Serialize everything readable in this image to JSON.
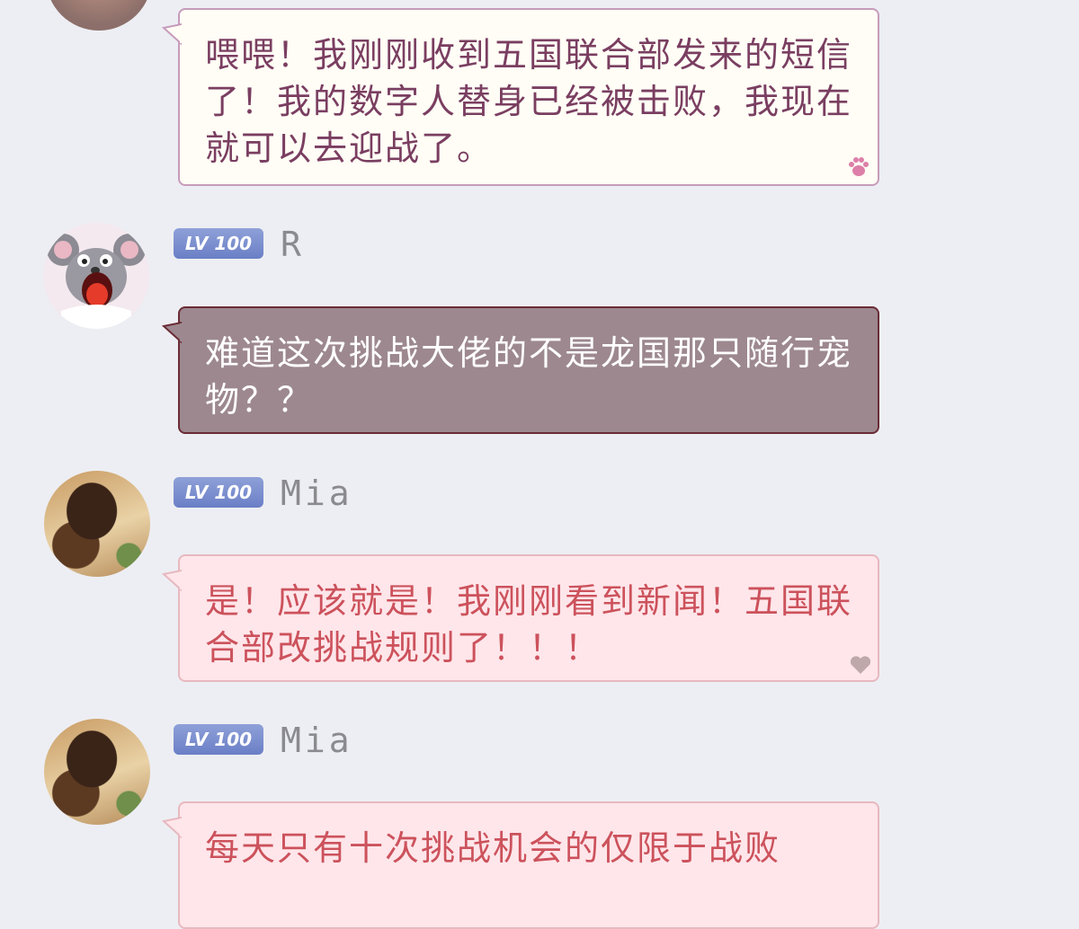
{
  "messages": [
    {
      "text": "喂喂！我刚刚收到五国联合部发来的短信了！我的数字人替身已经被击败，我现在就可以去迎战了。"
    },
    {
      "level": "LV 100",
      "username": "R",
      "text": "难道这次挑战大佬的不是龙国那只随行宠物？？"
    },
    {
      "level": "LV 100",
      "username": "Mia",
      "text": "是！应该就是！我刚刚看到新闻！五国联合部改挑战规则了！！！"
    },
    {
      "level": "LV 100",
      "username": "Mia",
      "text": "每天只有十次挑战机会的仅限于战败"
    }
  ],
  "colors": {
    "background": "#edeef3",
    "bubble_cream": "#fffdf5",
    "bubble_dark": "#9d8890",
    "bubble_pink": "#ffe6ea",
    "level_badge": "#7d90d0"
  },
  "icons": [
    "paw-icon",
    "heart-icon"
  ]
}
